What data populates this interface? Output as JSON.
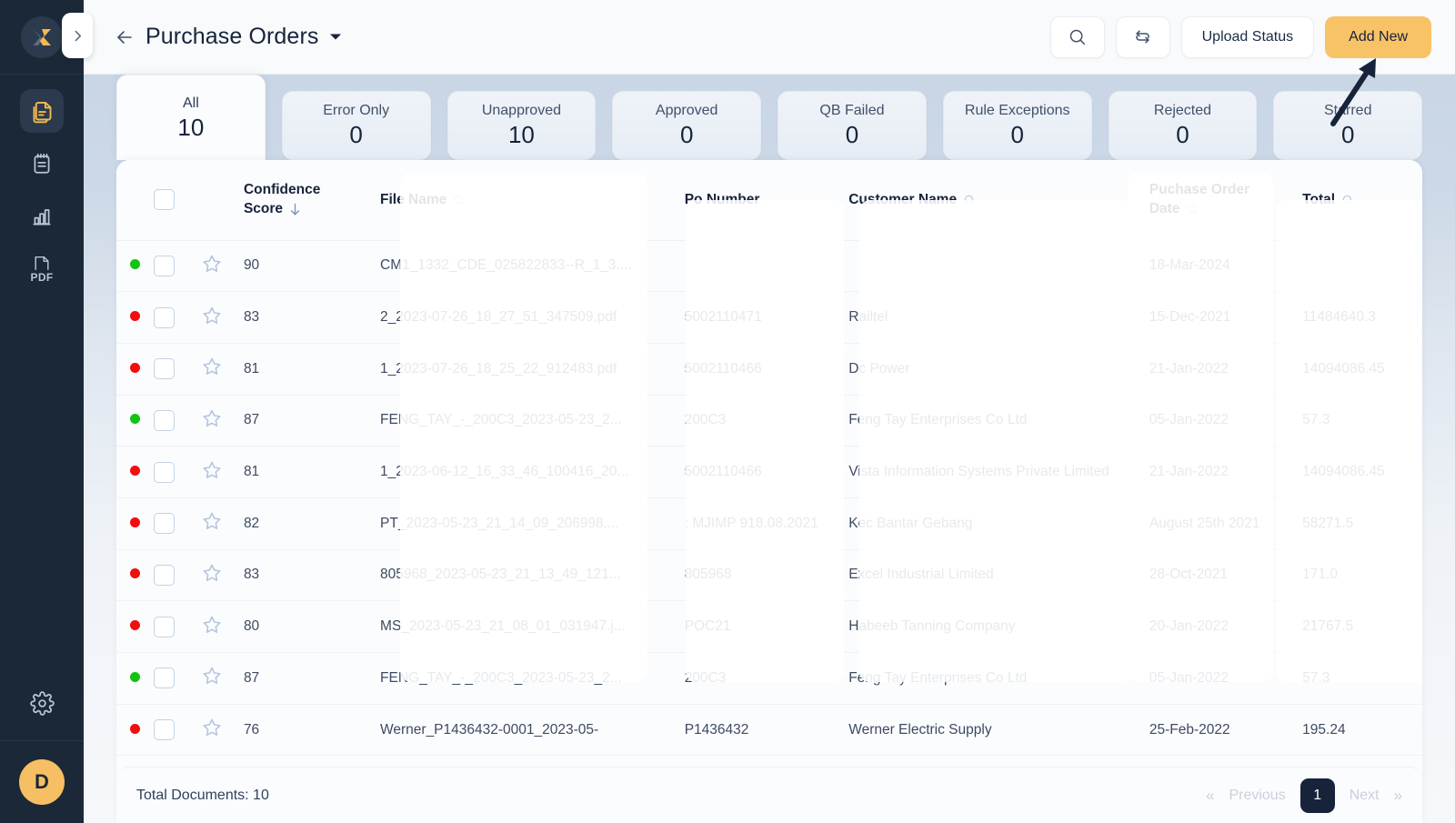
{
  "app": {
    "logo_icon": "x-star-logo-icon",
    "collapse_icon": "chevron-right-icon",
    "avatar_initial": "D"
  },
  "sidebar": {
    "items": [
      {
        "icon": "documents-icon",
        "name": "documents",
        "active": true
      },
      {
        "icon": "notepad-icon",
        "name": "notepad",
        "active": false
      },
      {
        "icon": "bar-chart-icon",
        "name": "analytics",
        "active": false
      },
      {
        "icon": "pdf-icon",
        "name": "pdf",
        "label": "PDF",
        "active": false
      }
    ],
    "settings_icon": "gear-icon"
  },
  "topbar": {
    "back_icon": "arrow-left-icon",
    "title": "Purchase Orders",
    "title_caret_icon": "caret-down-icon",
    "search_icon": "search-icon",
    "refresh_icon": "refresh-icon",
    "upload_status_label": "Upload Status",
    "add_new_label": "Add New",
    "add_new_color": "#f8c267"
  },
  "tabs": [
    {
      "label": "All",
      "count": "10",
      "active": true
    },
    {
      "label": "Error Only",
      "count": "0",
      "active": false
    },
    {
      "label": "Unapproved",
      "count": "10",
      "active": false
    },
    {
      "label": "Approved",
      "count": "0",
      "active": false
    },
    {
      "label": "QB Failed",
      "count": "0",
      "active": false
    },
    {
      "label": "Rule Exceptions",
      "count": "0",
      "active": false
    },
    {
      "label": "Rejected",
      "count": "0",
      "active": false
    },
    {
      "label": "Starred",
      "count": "0",
      "active": false
    }
  ],
  "table": {
    "headers": {
      "confidence_score_line1": "Confidence",
      "confidence_score_line2": "Score",
      "file_name": "File Name",
      "po_number": "Po Number",
      "customer_name": "Customer Name",
      "po_date_line1": "Puchase Order",
      "po_date_line2": "Date",
      "total": "Total"
    },
    "sort_icon": "arrow-down-icon",
    "search_icon": "search-icon",
    "select_all_checkbox": "unchecked",
    "rows": [
      {
        "status": "green",
        "score": "90",
        "file_name": "CM1_1332_CDE_025822833--R_1_3....",
        "po_number": "",
        "customer_name": "",
        "po_date": "18-Mar-2024",
        "total": ""
      },
      {
        "status": "red",
        "score": "83",
        "file_name": "2_2023-07-26_18_27_51_347509.pdf",
        "po_number": "5002110471",
        "customer_name": "Railtel",
        "po_date": "15-Dec-2021",
        "total": "11484640.3"
      },
      {
        "status": "red",
        "score": "81",
        "file_name": "1_2023-07-26_18_25_22_912483.pdf",
        "po_number": "5002110466",
        "customer_name": "Dc Power",
        "po_date": "21-Jan-2022",
        "total": "14094086.45"
      },
      {
        "status": "green",
        "score": "87",
        "file_name": "FENG_TAY_-_200C3_2023-05-23_2...",
        "po_number": "200C3",
        "customer_name": "Feng Tay Enterprises Co Ltd",
        "po_date": "05-Jan-2022",
        "total": "57.3"
      },
      {
        "status": "red",
        "score": "81",
        "file_name": "1_2023-06-12_16_33_46_100416_20...",
        "po_number": "5002110466",
        "customer_name": "Vista Information Systems Private Limited",
        "po_date": "21-Jan-2022",
        "total": "14094086.45"
      },
      {
        "status": "red",
        "score": "82",
        "file_name": "PT_2023-05-23_21_14_09_206998....",
        "po_number": ": MJIMP 918.08.2021",
        "customer_name": "Kec Bantar Gebang",
        "po_date": "August 25th 2021",
        "total": "58271.5"
      },
      {
        "status": "red",
        "score": "83",
        "file_name": "805968_2023-05-23_21_13_49_121...",
        "po_number": "805968",
        "customer_name": "Excel Industrial Limited",
        "po_date": "28-Oct-2021",
        "total": "171.0"
      },
      {
        "status": "red",
        "score": "80",
        "file_name": "MS_2023-05-23_21_08_01_031947.j...",
        "po_number": "POC21",
        "customer_name": "Habeeb Tanning Company",
        "po_date": "20-Jan-2022",
        "total": "21767.5"
      },
      {
        "status": "green",
        "score": "87",
        "file_name": "FENG_TAY_-_200C3_2023-05-23_2...",
        "po_number": "200C3",
        "customer_name": "Feng Tay Enterprises Co Ltd",
        "po_date": "05-Jan-2022",
        "total": "57.3"
      },
      {
        "status": "red",
        "score": "76",
        "file_name": "Werner_P1436432-0001_2023-05-",
        "po_number": "P1436432",
        "customer_name": "Werner Electric Supply",
        "po_date": "25-Feb-2022",
        "total": "195.24"
      }
    ]
  },
  "footer": {
    "total_documents": "Total Documents: 10",
    "first_chevron": "«",
    "previous_label": "Previous",
    "current_page": "1",
    "next_label": "Next",
    "last_chevron": "»"
  },
  "annotation": {
    "arrow_icon": "pointer-arrow-icon",
    "arrow_color": "#16233b"
  },
  "colors": {
    "status_green": "#12c312",
    "status_red": "#f30d0d",
    "sidebar_bg": "#1b2838",
    "accent": "#f8c267"
  }
}
